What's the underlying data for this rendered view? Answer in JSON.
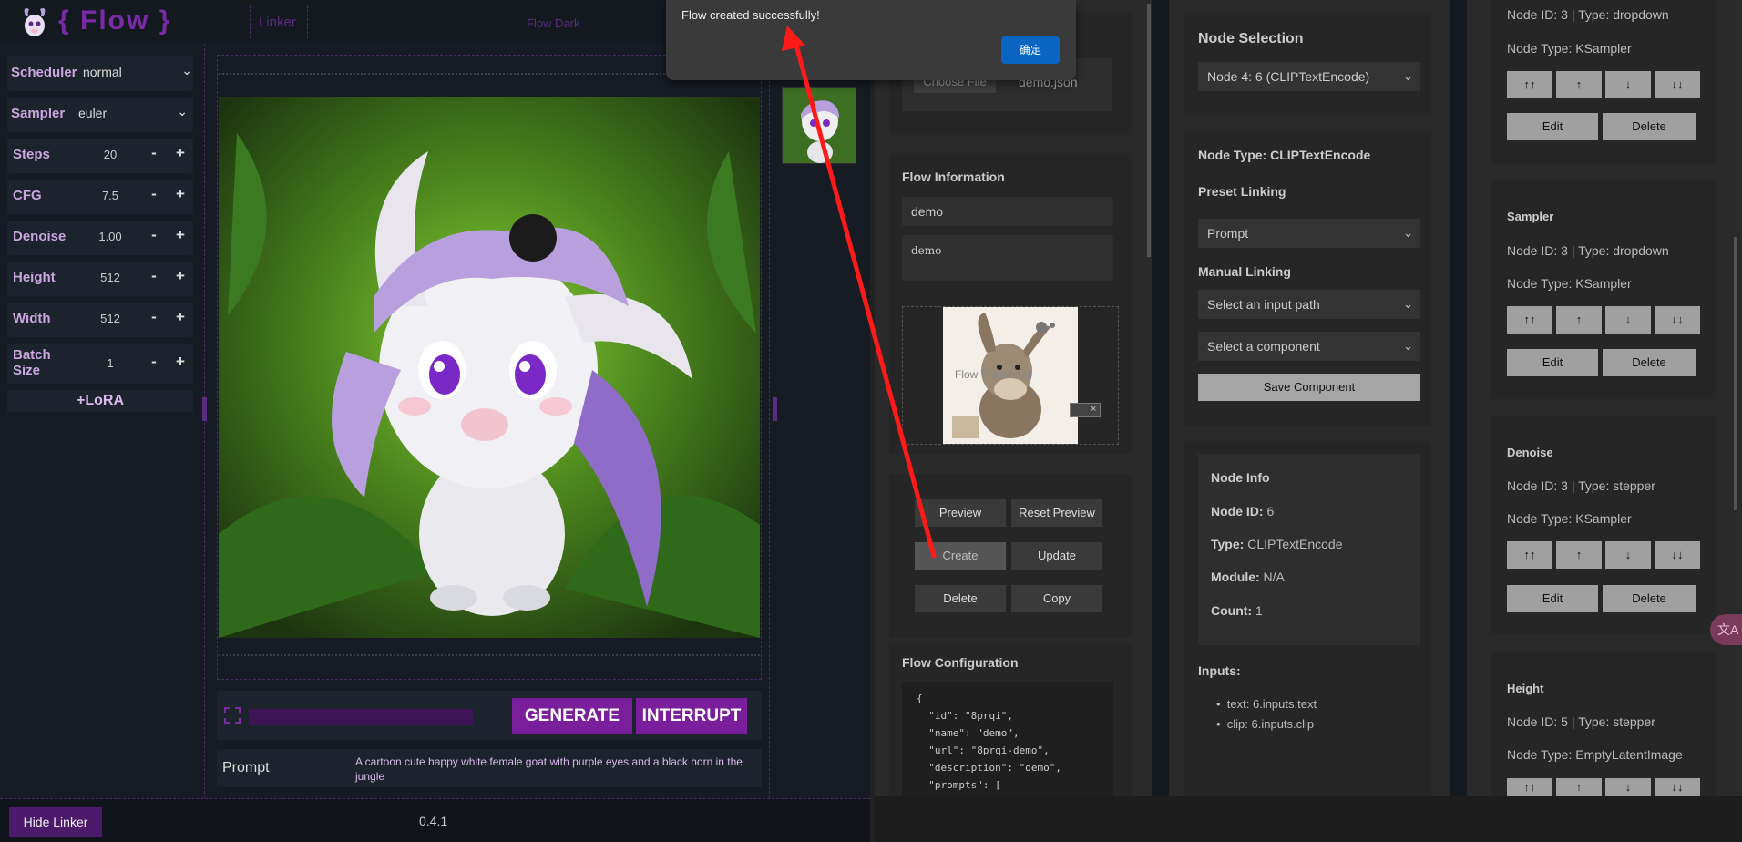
{
  "header": {
    "logo_text": "{ Flow }",
    "linker_link": "Linker",
    "theme_label": "Flow Dark"
  },
  "controls": {
    "scheduler": {
      "label": "Scheduler",
      "value": "normal"
    },
    "sampler": {
      "label": "Sampler",
      "value": "euler"
    },
    "steps": {
      "label": "Steps",
      "value": "20"
    },
    "cfg": {
      "label": "CFG",
      "value": "7.5"
    },
    "denoise": {
      "label": "Denoise",
      "value": "1.00"
    },
    "height": {
      "label": "Height",
      "value": "512"
    },
    "width": {
      "label": "Width",
      "value": "512"
    },
    "batch_size": {
      "label": "Batch Size",
      "value": "1"
    },
    "minus": "-",
    "plus": "+",
    "lora_button": "+LoRA"
  },
  "generation": {
    "progress": 0,
    "generate_button": "GENERATE",
    "interrupt_button": "INTERRUPT",
    "prompt_label": "Prompt",
    "prompt_text": "A cartoon cute happy white female goat with purple eyes and a black horn in the jungle"
  },
  "footer": {
    "hide_linker_button": "Hide Linker",
    "version": "0.4.1"
  },
  "alert": {
    "message": "Flow created successfully!",
    "ok_button": "确定"
  },
  "flow_file": {
    "choose_file_button": "Choose File",
    "file_name": "demo.json"
  },
  "flow_information": {
    "title": "Flow Information",
    "name_value": "demo",
    "description_value": "demo",
    "thumbnail_alt": "Flow Thumbnail"
  },
  "flow_actions": {
    "preview": "Preview",
    "reset_preview": "Reset Preview",
    "create": "Create",
    "update": "Update",
    "delete": "Delete",
    "copy": "Copy"
  },
  "flow_configuration": {
    "title": "Flow Configuration",
    "lines": [
      "{",
      "  \"id\": \"8prqi\",",
      "  \"name\": \"demo\",",
      "  \"url\": \"8prqi-demo\",",
      "  \"description\": \"demo\",",
      "  \"prompts\": ["
    ]
  },
  "node_selection": {
    "title": "Node Selection",
    "selected": "Node 4: 6 (CLIPTextEncode)",
    "node_type_label": "Node Type: CLIPTextEncode",
    "preset_linking_label": "Preset Linking",
    "preset_value": "Prompt",
    "manual_linking_label": "Manual Linking",
    "input_path_placeholder": "Select an input path",
    "component_placeholder": "Select a component",
    "save_component_button": "Save Component"
  },
  "node_info": {
    "title": "Node Info",
    "node_id_label": "Node ID:",
    "node_id_value": "6",
    "type_label": "Type:",
    "type_value": "CLIPTextEncode",
    "module_label": "Module:",
    "module_value": "N/A",
    "count_label": "Count:",
    "count_value": "1",
    "inputs_label": "Inputs:",
    "inputs": [
      "text: 6.inputs.text",
      "clip: 6.inputs.clip"
    ]
  },
  "components": {
    "move_top": "↑↑",
    "move_up": "↑",
    "move_down": "↓",
    "move_bottom": "↓↓",
    "edit": "Edit",
    "delete": "Delete",
    "items": [
      {
        "title": "",
        "meta": "Node ID: 3 | Type: dropdown",
        "node_type": "Node Type: KSampler"
      },
      {
        "title": "Sampler",
        "meta": "Node ID: 3 | Type: dropdown",
        "node_type": "Node Type: KSampler"
      },
      {
        "title": "Denoise",
        "meta": "Node ID: 3 | Type: stepper",
        "node_type": "Node Type: KSampler"
      },
      {
        "title": "Height",
        "meta": "Node ID: 5 | Type: stepper",
        "node_type": "Node Type: EmptyLatentImage"
      }
    ]
  },
  "colors": {
    "accent_purple": "#7a1e9c",
    "alert_ok_blue": "#0a66c2",
    "annotation_arrow": "#ff1a1a"
  }
}
